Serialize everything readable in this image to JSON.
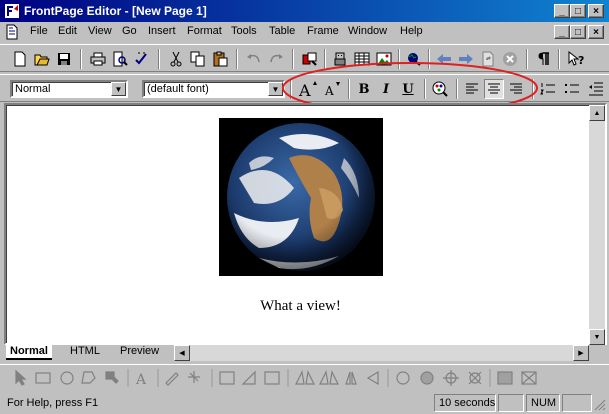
{
  "window": {
    "title": "FrontPage Editor - [New Page 1]",
    "min_glyph": "_",
    "max_glyph": "□",
    "close_glyph": "×"
  },
  "menu": [
    "File",
    "Edit",
    "View",
    "Go",
    "Insert",
    "Format",
    "Tools",
    "Table",
    "Frame",
    "Window",
    "Help"
  ],
  "format_toolbar": {
    "style_value": "Normal",
    "font_value": "(default font)",
    "bold_label": "B",
    "italic_label": "I",
    "underline_label": "U"
  },
  "document": {
    "caption": "What a view!"
  },
  "view_tabs": [
    "Normal",
    "HTML",
    "Preview"
  ],
  "status": {
    "help_text": "For Help, press F1",
    "download_time": "10 seconds",
    "num_lock": "NUM"
  },
  "colors": {
    "title_bar_start": "#000080",
    "title_bar_end": "#1084d0",
    "highlight_ellipse": "#e02020",
    "face": "#c0c0c0"
  }
}
